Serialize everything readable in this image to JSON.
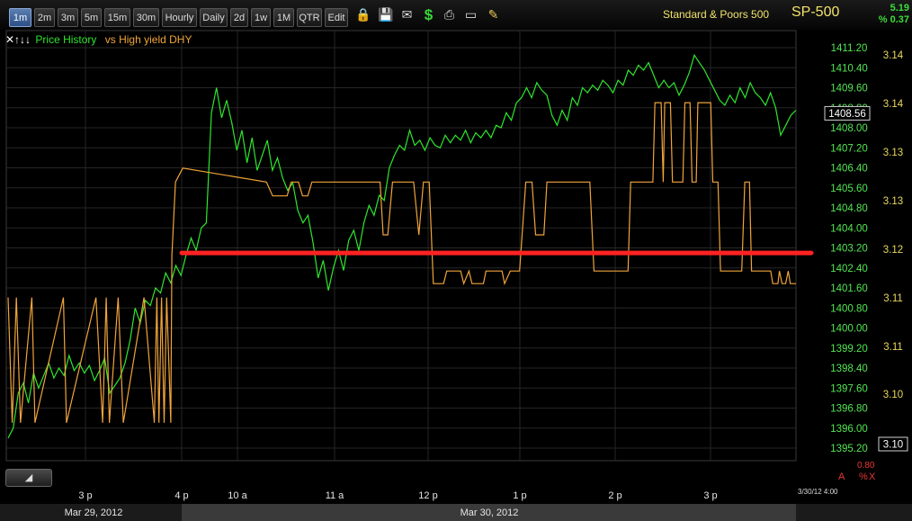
{
  "toolbar": {
    "timeframes": [
      "1m",
      "2m",
      "3m",
      "5m",
      "15m",
      "30m",
      "Hourly",
      "Daily",
      "2d",
      "1w",
      "1M",
      "QTR",
      "Edit"
    ],
    "active": "1m",
    "icons": [
      "lock-icon",
      "save-icon",
      "email-icon",
      "dollar-icon",
      "print-icon",
      "window-icon",
      "pencil-icon"
    ]
  },
  "symbol": {
    "name": "Standard & Poors 500",
    "ticker": "SP-500",
    "change": "5.19",
    "change_pct": "% 0.37"
  },
  "legend": {
    "controls": "✕↑↓↓",
    "series1": "Price History",
    "series2": "vs High yield DHY"
  },
  "footer": {
    "dates": [
      "Mar 29, 2012",
      "Mar 30, 2012"
    ],
    "timestamp": "3/30/12 4:00",
    "pct_value": "0.80",
    "pct_letters": [
      "A",
      "%",
      "X"
    ]
  },
  "colors": {
    "price": "#2ee62e",
    "dhy": "#f0a43a",
    "support_line": "#ff2222",
    "axis_left": "#53e653",
    "axis_right": "#e9d95a"
  },
  "chart_data": {
    "type": "line",
    "x_ticks": [
      "3 p",
      "4 p",
      "10 a",
      "11 a",
      "12 p",
      "1 p",
      "2 p",
      "3 p"
    ],
    "price_axis": {
      "ticks": [
        "1411.20",
        "1410.40",
        "1409.60",
        "1408.80",
        "1408.00",
        "1407.20",
        "1406.40",
        "1405.60",
        "1404.80",
        "1404.00",
        "1403.20",
        "1402.40",
        "1401.60",
        "1400.80",
        "1400.00",
        "1399.20",
        "1398.40",
        "1397.60",
        "1396.80",
        "1396.00",
        "1395.20"
      ],
      "current": "1408.56",
      "ylim": [
        1394.6,
        1412.1
      ]
    },
    "dhy_axis": {
      "ticks": [
        "3.14",
        "3.14",
        "3.13",
        "3.13",
        "3.12",
        "3.11",
        "3.11",
        "3.10"
      ],
      "current": "3.10"
    },
    "series": [
      {
        "name": "Price History",
        "values": [
          1395.6,
          1396.0,
          1397.4,
          1397.8,
          1397.0,
          1398.2,
          1397.6,
          1398.1,
          1398.6,
          1398.0,
          1398.4,
          1398.1,
          1398.9,
          1398.3,
          1398.6,
          1398.2,
          1398.5,
          1397.9,
          1398.3,
          1398.8,
          1397.4,
          1397.7,
          1398.0,
          1398.6,
          1399.5,
          1400.8,
          1400.2,
          1401.1,
          1400.9,
          1401.6,
          1401.4,
          1402.2,
          1401.8,
          1402.5,
          1402.1,
          1402.9,
          1403.6,
          1403.1,
          1404.0,
          1404.2,
          1408.6,
          1409.6,
          1408.4,
          1409.1,
          1408.2,
          1407.1,
          1407.9,
          1406.6,
          1407.6,
          1406.3,
          1406.9,
          1407.5,
          1406.3,
          1406.8,
          1406.0,
          1405.5,
          1405.8,
          1404.7,
          1404.2,
          1404.5,
          1403.4,
          1402.0,
          1402.7,
          1401.5,
          1402.4,
          1403.1,
          1402.3,
          1403.5,
          1403.9,
          1403.1,
          1404.2,
          1404.9,
          1404.5,
          1405.3,
          1405.1,
          1406.4,
          1406.9,
          1407.3,
          1407.1,
          1407.9,
          1407.3,
          1407.5,
          1407.1,
          1407.6,
          1407.3,
          1407.2,
          1407.7,
          1407.4,
          1407.7,
          1407.5,
          1407.9,
          1407.4,
          1407.8,
          1407.6,
          1407.9,
          1407.6,
          1408.1,
          1408.0,
          1408.6,
          1408.3,
          1409.0,
          1409.2,
          1409.6,
          1409.2,
          1409.8,
          1409.5,
          1409.3,
          1408.5,
          1408.1,
          1408.7,
          1408.3,
          1409.2,
          1408.9,
          1409.6,
          1409.4,
          1409.7,
          1409.5,
          1409.9,
          1409.7,
          1409.4,
          1409.9,
          1409.7,
          1410.3,
          1410.1,
          1410.5,
          1410.3,
          1410.6,
          1410.1,
          1409.6,
          1409.9,
          1409.6,
          1409.8,
          1409.3,
          1409.7,
          1410.2,
          1410.9,
          1410.6,
          1410.3,
          1409.9,
          1409.5,
          1409.1,
          1408.9,
          1409.3,
          1409.0,
          1409.6,
          1409.2,
          1409.8,
          1409.4,
          1409.2,
          1408.9,
          1409.4,
          1408.8,
          1407.7,
          1408.1,
          1408.5,
          1408.7
        ]
      },
      {
        "name": "vs High yield DHY",
        "steps": [
          [
            0,
            3.109
          ],
          [
            0.8,
            3.1
          ],
          [
            1.6,
            3.109
          ],
          [
            2.4,
            3.1
          ],
          [
            4.6,
            3.109
          ],
          [
            5.2,
            3.1
          ],
          [
            10.7,
            3.109
          ],
          [
            11.3,
            3.1
          ],
          [
            17,
            3.109
          ],
          [
            18.3,
            3.1
          ],
          [
            19,
            3.109
          ],
          [
            19.6,
            3.1
          ],
          [
            21.3,
            3.109
          ],
          [
            22.3,
            3.1
          ],
          [
            26.3,
            3.109
          ],
          [
            28.3,
            3.1
          ],
          [
            28.8,
            3.109
          ],
          [
            29.2,
            3.1
          ],
          [
            29.7,
            3.109
          ],
          [
            30.2,
            3.1
          ],
          [
            30.7,
            3.109
          ],
          [
            31.5,
            3.1
          ],
          [
            31.7,
            3.112
          ],
          [
            32.4,
            3.1173
          ],
          [
            33.8,
            3.1183
          ],
          [
            50,
            3.1173
          ],
          [
            51.2,
            3.1163
          ],
          [
            52,
            3.1163
          ],
          [
            54,
            3.1163
          ],
          [
            54.8,
            3.1173
          ],
          [
            56.2,
            3.1173
          ],
          [
            57,
            3.1163
          ],
          [
            58,
            3.1163
          ],
          [
            58.8,
            3.1173
          ],
          [
            60.6,
            3.1173
          ],
          [
            62,
            3.1173
          ],
          [
            63,
            3.1173
          ],
          [
            72,
            3.1173
          ],
          [
            72.6,
            3.1135
          ],
          [
            73.5,
            3.1135
          ],
          [
            74.4,
            3.1173
          ],
          [
            78,
            3.1173
          ],
          [
            78.5,
            3.1173
          ],
          [
            79.5,
            3.1135
          ],
          [
            80.4,
            3.1173
          ],
          [
            81.5,
            3.1173
          ],
          [
            82.3,
            3.11
          ],
          [
            84.3,
            3.11
          ],
          [
            84.9,
            3.1109
          ],
          [
            87.6,
            3.1109
          ],
          [
            88.2,
            3.11
          ],
          [
            89.2,
            3.1109
          ],
          [
            89.8,
            3.11
          ],
          [
            92,
            3.11
          ],
          [
            92.5,
            3.1109
          ],
          [
            95.6,
            3.1109
          ],
          [
            96.1,
            3.11
          ],
          [
            97.2,
            3.1109
          ],
          [
            99,
            3.1109
          ],
          [
            100.2,
            3.1173
          ],
          [
            101.4,
            3.1173
          ],
          [
            102.1,
            3.1135
          ],
          [
            103.7,
            3.1135
          ],
          [
            104.3,
            3.1173
          ],
          [
            112.6,
            3.1173
          ],
          [
            113.4,
            3.1109
          ],
          [
            120,
            3.1109
          ],
          [
            120.5,
            3.1173
          ],
          [
            124.8,
            3.1173
          ],
          [
            125.2,
            3.123
          ],
          [
            126.4,
            3.123
          ],
          [
            126.8,
            3.1173
          ],
          [
            127.1,
            3.123
          ],
          [
            128.2,
            3.123
          ],
          [
            128.6,
            3.1173
          ],
          [
            130.6,
            3.1173
          ],
          [
            131,
            3.123
          ],
          [
            132,
            3.123
          ],
          [
            132.4,
            3.1173
          ],
          [
            133.2,
            3.1173
          ],
          [
            133.5,
            3.123
          ],
          [
            136,
            3.123
          ],
          [
            136.4,
            3.1173
          ],
          [
            137.4,
            3.1173
          ],
          [
            137.9,
            3.1109
          ],
          [
            142,
            3.1109
          ],
          [
            142.6,
            3.1173
          ],
          [
            143.5,
            3.1173
          ],
          [
            143.9,
            3.1109
          ],
          [
            147.6,
            3.1109
          ],
          [
            148,
            3.11
          ],
          [
            149,
            3.11
          ],
          [
            149.3,
            3.1109
          ],
          [
            149.8,
            3.11
          ],
          [
            150.5,
            3.11
          ],
          [
            151,
            3.1109
          ],
          [
            151.4,
            3.11
          ],
          [
            152.5,
            3.11
          ]
        ],
        "ylim": [
          3.0985,
          3.1265
        ]
      }
    ],
    "support_level": 1403.0
  }
}
